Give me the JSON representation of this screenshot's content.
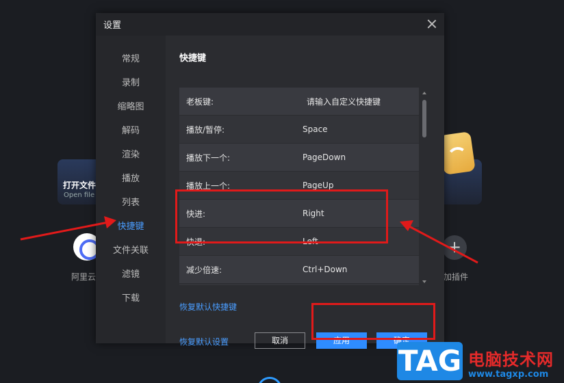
{
  "background": {
    "open_file_title": "打开文件",
    "open_file_sub": "Open file",
    "aliyun_label": "阿里云",
    "add_plugin_label": "加插件",
    "plus_glyph": "+"
  },
  "dialog": {
    "title": "设置",
    "sidebar": {
      "items": [
        {
          "label": "常规"
        },
        {
          "label": "录制"
        },
        {
          "label": "缩略图"
        },
        {
          "label": "解码"
        },
        {
          "label": "渲染"
        },
        {
          "label": "播放"
        },
        {
          "label": "列表"
        },
        {
          "label": "快捷键"
        },
        {
          "label": "文件关联"
        },
        {
          "label": "滤镜"
        },
        {
          "label": "下载"
        }
      ],
      "active_index": 7
    },
    "section_title": "快捷键",
    "shortcuts": [
      {
        "label": "老板键:",
        "value": "请输入自定义快捷键"
      },
      {
        "label": "播放/暂停:",
        "value": "Space"
      },
      {
        "label": "播放下一个:",
        "value": "PageDown"
      },
      {
        "label": "播放上一个:",
        "value": "PageUp"
      },
      {
        "label": "快进:",
        "value": "Right"
      },
      {
        "label": "快退:",
        "value": "Left"
      },
      {
        "label": "减少倍速:",
        "value": "Ctrl+Down"
      },
      {
        "label": "",
        "value": ""
      }
    ],
    "restore_shortcuts_label": "恢复默认快捷键",
    "restore_settings_label": "恢复默认设置",
    "cancel_label": "取消",
    "apply_label": "应用",
    "ok_label": "确定"
  },
  "watermark": {
    "tag": "TAG",
    "site_name": "电脑技术网",
    "url": "www.tagxp.com"
  },
  "colors": {
    "accent": "#2e8cff",
    "highlight": "#e11a1a"
  }
}
